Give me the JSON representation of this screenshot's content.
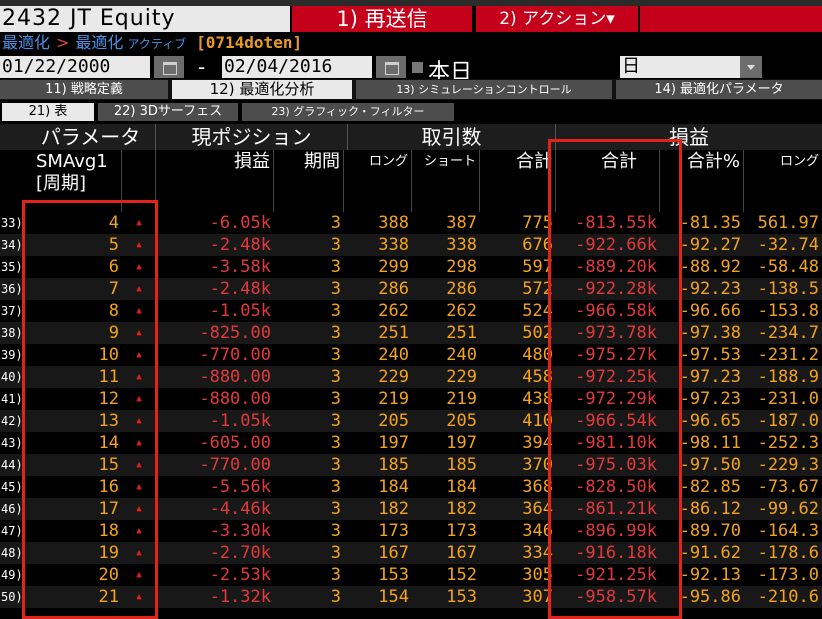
{
  "ticker": "2432 JT Equity",
  "header_buttons": {
    "resend": "1) 再送信",
    "action": "2) アクション▾"
  },
  "breadcrumb": {
    "a": "最適化",
    "sep": ">",
    "b": "最適化",
    "c": "アクティブ",
    "d": "[0714doten]"
  },
  "dates": {
    "from": "01/22/2000",
    "dash": "-",
    "to": "02/04/2016",
    "today": "本日",
    "period": "日"
  },
  "tabs": [
    {
      "label": "11) 戦略定義"
    },
    {
      "label": "12) 最適化分析"
    },
    {
      "label": "13) シミュレーションコントロール"
    },
    {
      "label": "14) 最適化パラメータ"
    }
  ],
  "subtabs": [
    {
      "label": "21) 表"
    },
    {
      "label": "22) 3Dサーフェス"
    },
    {
      "label": "23) グラフィック・フィルター"
    }
  ],
  "header_groups": {
    "param": "パラメータ",
    "position": "現ポジション",
    "trades": "取引数",
    "pnl": "損益"
  },
  "columns": {
    "sma": "SMAvg1",
    "sma_sub": "[周期]",
    "pos_pnl": "損益",
    "period": "期間",
    "long": "ロング",
    "short": "ショート",
    "total": "合計",
    "pnl_total": "合計",
    "pnl_pct": "合計%",
    "pnl_long": "ロング"
  },
  "colors": {
    "accent_red": "#c4001a",
    "value_orange": "#f4a31a",
    "negative_red": "#e23a3a",
    "highlight_red": "#e2231a"
  },
  "rows": [
    {
      "n": "33)",
      "sma": "4",
      "pos": "-6.05k",
      "per": "3",
      "long": "388",
      "short": "387",
      "total": "775",
      "pnl": "-813.55k",
      "pct": "-81.35",
      "pl": "561.97"
    },
    {
      "n": "34)",
      "sma": "5",
      "pos": "-2.48k",
      "per": "3",
      "long": "338",
      "short": "338",
      "total": "676",
      "pnl": "-922.66k",
      "pct": "-92.27",
      "pl": "-32.74"
    },
    {
      "n": "35)",
      "sma": "6",
      "pos": "-3.58k",
      "per": "3",
      "long": "299",
      "short": "298",
      "total": "597",
      "pnl": "-889.20k",
      "pct": "-88.92",
      "pl": "-58.48"
    },
    {
      "n": "36)",
      "sma": "7",
      "pos": "-2.48k",
      "per": "3",
      "long": "286",
      "short": "286",
      "total": "572",
      "pnl": "-922.28k",
      "pct": "-92.23",
      "pl": "-138.5"
    },
    {
      "n": "37)",
      "sma": "8",
      "pos": "-1.05k",
      "per": "3",
      "long": "262",
      "short": "262",
      "total": "524",
      "pnl": "-966.58k",
      "pct": "-96.66",
      "pl": "-153.8"
    },
    {
      "n": "38)",
      "sma": "9",
      "pos": "-825.00",
      "per": "3",
      "long": "251",
      "short": "251",
      "total": "502",
      "pnl": "-973.78k",
      "pct": "-97.38",
      "pl": "-234.7"
    },
    {
      "n": "39)",
      "sma": "10",
      "pos": "-770.00",
      "per": "3",
      "long": "240",
      "short": "240",
      "total": "480",
      "pnl": "-975.27k",
      "pct": "-97.53",
      "pl": "-231.2"
    },
    {
      "n": "40)",
      "sma": "11",
      "pos": "-880.00",
      "per": "3",
      "long": "229",
      "short": "229",
      "total": "458",
      "pnl": "-972.25k",
      "pct": "-97.23",
      "pl": "-188.9"
    },
    {
      "n": "41)",
      "sma": "12",
      "pos": "-880.00",
      "per": "3",
      "long": "219",
      "short": "219",
      "total": "438",
      "pnl": "-972.29k",
      "pct": "-97.23",
      "pl": "-231.0"
    },
    {
      "n": "42)",
      "sma": "13",
      "pos": "-1.05k",
      "per": "3",
      "long": "205",
      "short": "205",
      "total": "410",
      "pnl": "-966.54k",
      "pct": "-96.65",
      "pl": "-187.0"
    },
    {
      "n": "43)",
      "sma": "14",
      "pos": "-605.00",
      "per": "3",
      "long": "197",
      "short": "197",
      "total": "394",
      "pnl": "-981.10k",
      "pct": "-98.11",
      "pl": "-252.3"
    },
    {
      "n": "44)",
      "sma": "15",
      "pos": "-770.00",
      "per": "3",
      "long": "185",
      "short": "185",
      "total": "370",
      "pnl": "-975.03k",
      "pct": "-97.50",
      "pl": "-229.3"
    },
    {
      "n": "45)",
      "sma": "16",
      "pos": "-5.56k",
      "per": "3",
      "long": "184",
      "short": "184",
      "total": "368",
      "pnl": "-828.50k",
      "pct": "-82.85",
      "pl": "-73.67"
    },
    {
      "n": "46)",
      "sma": "17",
      "pos": "-4.46k",
      "per": "3",
      "long": "182",
      "short": "182",
      "total": "364",
      "pnl": "-861.21k",
      "pct": "-86.12",
      "pl": "-99.62"
    },
    {
      "n": "47)",
      "sma": "18",
      "pos": "-3.30k",
      "per": "3",
      "long": "173",
      "short": "173",
      "total": "346",
      "pnl": "-896.99k",
      "pct": "-89.70",
      "pl": "-164.3"
    },
    {
      "n": "48)",
      "sma": "19",
      "pos": "-2.70k",
      "per": "3",
      "long": "167",
      "short": "167",
      "total": "334",
      "pnl": "-916.18k",
      "pct": "-91.62",
      "pl": "-178.6"
    },
    {
      "n": "49)",
      "sma": "20",
      "pos": "-2.53k",
      "per": "3",
      "long": "153",
      "short": "152",
      "total": "305",
      "pnl": "-921.25k",
      "pct": "-92.13",
      "pl": "-173.0"
    },
    {
      "n": "50)",
      "sma": "21",
      "pos": "-1.32k",
      "per": "3",
      "long": "154",
      "short": "153",
      "total": "307",
      "pnl": "-958.57k",
      "pct": "-95.86",
      "pl": "-210.6"
    }
  ]
}
